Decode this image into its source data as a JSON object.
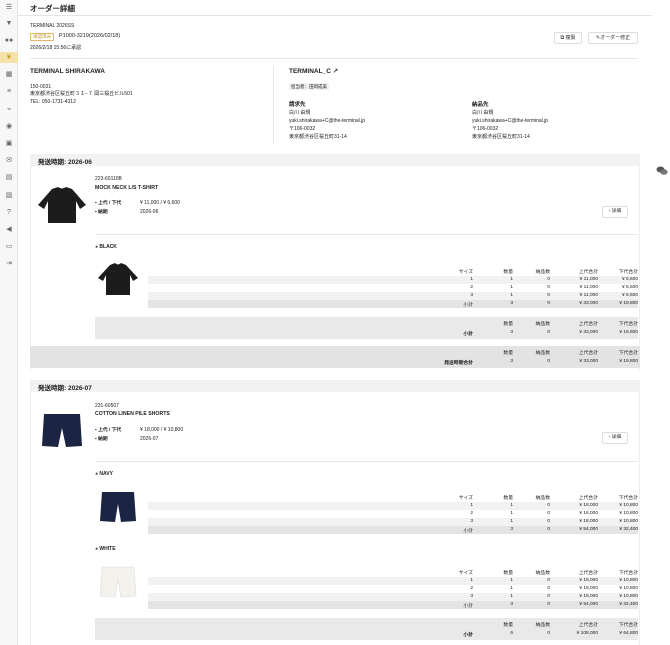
{
  "page_title": "オーダー詳細",
  "order": {
    "brand_name": "TERMINAL 2026SS",
    "status_badge": "承認済み",
    "order_no": "P1000-3219(2026/02/18)",
    "approved_at": "2026/2/18 15:56に承認",
    "copy_label": "複製",
    "edit_label": "オーダー修正"
  },
  "seller": {
    "name": "TERMINAL SHIRAKAWA",
    "postal": "150-0031",
    "address": "東京都渋谷区桜丘町３１−７ 岡三桜丘ビル501",
    "tel": "TEL: 050-1731-4312"
  },
  "buyer": {
    "name": "TERMINAL_C",
    "staff": "担当者：田岡成美",
    "billing": {
      "heading": "請求先",
      "name": "白川 由規",
      "email": "yuki.shirakawa+C@the-terminal.jp",
      "postal": "〒106-0032",
      "address": "東京都渋谷区桜丘町31-14"
    },
    "delivery": {
      "heading": "納品先",
      "name": "白川 由規",
      "email": "yuki.shirakawa+C@the-terminal.jp",
      "postal": "〒106-0032",
      "address": "東京都渋谷区桜丘町31-14"
    }
  },
  "labels": {
    "price": "上代 / 下代",
    "delivery": "納期",
    "detail_button": "詳細",
    "size": "サイズ",
    "qty": "数量",
    "delivered": "納品数",
    "retail_total": "上代合計",
    "wholesale_total": "下代合計",
    "subtotal": "小計",
    "period_total": "発送時期合計"
  },
  "shipments": [
    {
      "heading": "発送時期: 2026-06",
      "product": {
        "code": "223-60110B",
        "name": "MOCK NECK L/S T-SHIRT",
        "price": "¥ 11,000 / ¥ 6,600",
        "delivery": "2026-06"
      },
      "colors": [
        {
          "name": "BLACK",
          "rows": [
            {
              "size": "1",
              "qty": "1",
              "delivered": "0",
              "retail": "¥ 11,000",
              "wholesale": "¥ 6,600"
            },
            {
              "size": "2",
              "qty": "1",
              "delivered": "0",
              "retail": "¥ 11,000",
              "wholesale": "¥ 6,600"
            },
            {
              "size": "3",
              "qty": "1",
              "delivered": "0",
              "retail": "¥ 11,000",
              "wholesale": "¥ 6,600"
            }
          ],
          "subtotal": {
            "qty": "3",
            "delivered": "0",
            "retail": "¥ 33,000",
            "wholesale": "¥ 19,800"
          }
        }
      ],
      "product_total": {
        "qty": "3",
        "delivered": "0",
        "retail": "¥ 33,000",
        "wholesale": "¥ 19,800"
      },
      "period_total": {
        "qty": "3",
        "delivered": "0",
        "retail": "¥ 33,000",
        "wholesale": "¥ 19,800"
      }
    },
    {
      "heading": "発送時期: 2026-07",
      "product": {
        "code": "231-60507",
        "name": "COTTON LINEN PILE SHORTS",
        "price": "¥ 18,000 / ¥ 10,800",
        "delivery": "2026-07"
      },
      "colors": [
        {
          "name": "NAVY",
          "rows": [
            {
              "size": "1",
              "qty": "1",
              "delivered": "0",
              "retail": "¥ 18,000",
              "wholesale": "¥ 10,800"
            },
            {
              "size": "2",
              "qty": "1",
              "delivered": "0",
              "retail": "¥ 18,000",
              "wholesale": "¥ 10,800"
            },
            {
              "size": "3",
              "qty": "1",
              "delivered": "0",
              "retail": "¥ 18,000",
              "wholesale": "¥ 10,800"
            }
          ],
          "subtotal": {
            "qty": "3",
            "delivered": "0",
            "retail": "¥ 54,000",
            "wholesale": "¥ 32,400"
          }
        },
        {
          "name": "WHITE",
          "rows": [
            {
              "size": "1",
              "qty": "1",
              "delivered": "0",
              "retail": "¥ 18,000",
              "wholesale": "¥ 10,800"
            },
            {
              "size": "2",
              "qty": "1",
              "delivered": "0",
              "retail": "¥ 18,000",
              "wholesale": "¥ 10,800"
            },
            {
              "size": "3",
              "qty": "1",
              "delivered": "0",
              "retail": "¥ 18,000",
              "wholesale": "¥ 10,800"
            }
          ],
          "subtotal": {
            "qty": "3",
            "delivered": "0",
            "retail": "¥ 54,000",
            "wholesale": "¥ 32,400"
          }
        }
      ],
      "product_total": {
        "qty": "6",
        "delivered": "0",
        "retail": "¥ 108,000",
        "wholesale": "¥ 64,800"
      }
    }
  ],
  "sidebar_icons": [
    "menu-icon",
    "tshirt-icon",
    "users-icon",
    "yen-icon",
    "calendar-icon",
    "list-icon",
    "percent-icon",
    "chart-icon",
    "chat-icon",
    "box-icon",
    "mail-icon",
    "table-icon",
    "image-icon",
    "help-icon",
    "megaphone-icon",
    "id-card-icon",
    "logout-icon"
  ]
}
